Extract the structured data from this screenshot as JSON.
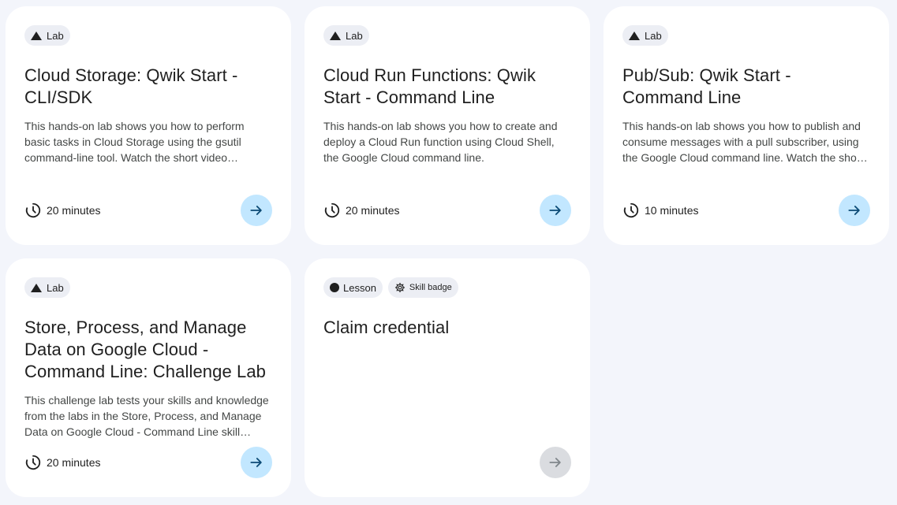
{
  "cards": [
    {
      "chips": [
        "Lab"
      ],
      "title": "Cloud Storage: Qwik Start - CLI/SDK",
      "description": "This hands-on lab shows you how to perform basic tasks in Cloud Storage using the gsutil command-line tool. Watch the short video…",
      "duration": "20 minutes",
      "arrow_icon": "arrow-right-icon"
    },
    {
      "chips": [
        "Lab"
      ],
      "title": "Cloud Run Functions: Qwik Start - Command Line",
      "description": "This hands-on lab shows you how to create and deploy a Cloud Run function using Cloud Shell, the Google Cloud command line.",
      "duration": "20 minutes",
      "arrow_icon": "arrow-right-icon"
    },
    {
      "chips": [
        "Lab"
      ],
      "title": "Pub/Sub: Qwik Start - Command Line",
      "description": "This hands-on lab shows you how to publish and consume messages with a pull subscriber, using the Google Cloud command line. Watch the sho…",
      "duration": "10 minutes",
      "arrow_icon": "arrow-right-icon"
    },
    {
      "chips": [
        "Lab"
      ],
      "title": "Store, Process, and Manage Data on Google Cloud - Command Line: Challenge Lab",
      "description": "This challenge lab tests your skills and knowledge from the labs in the Store, Process, and Manage Data on Google Cloud - Command Line skill…",
      "duration": "20 minutes",
      "arrow_icon": "arrow-right-icon"
    },
    {
      "chips": [
        "Lesson",
        "Skill badge"
      ],
      "title": "Claim credential",
      "description": "",
      "duration": "",
      "arrow_icon": "arrow-right-icon",
      "arrow_disabled": true
    }
  ],
  "colors": {
    "page_bg": "#f3f5fb",
    "card_bg": "#ffffff",
    "chip_bg": "#eceef4",
    "arrow_bg": "#c2e7ff",
    "arrow_fg": "#0b4a75",
    "arrow_disabled_bg": "#dadce0",
    "arrow_disabled_fg": "#80868b"
  }
}
